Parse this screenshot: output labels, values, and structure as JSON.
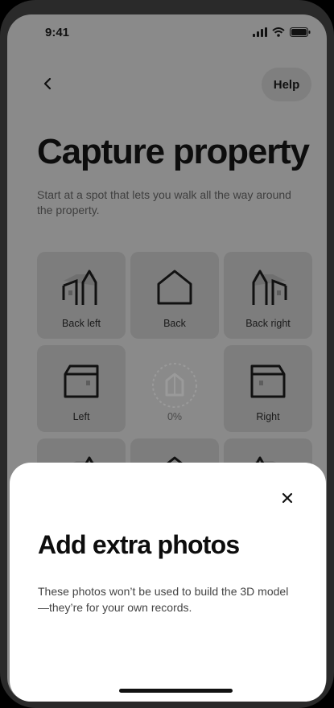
{
  "status_bar": {
    "time": "9:41"
  },
  "nav": {
    "help_label": "Help"
  },
  "header": {
    "title": "Capture property",
    "subtitle": "Start at a spot that lets you walk all the way around the property."
  },
  "tiles": [
    {
      "label": "Back left",
      "icon": "house-back-left-icon"
    },
    {
      "label": "Back",
      "icon": "house-back-icon"
    },
    {
      "label": "Back right",
      "icon": "house-back-right-icon"
    },
    {
      "label": "Left",
      "icon": "house-left-icon"
    },
    {
      "label": "0%",
      "icon": "progress-house-icon",
      "progress": 0
    },
    {
      "label": "Right",
      "icon": "house-right-icon"
    }
  ],
  "sheet": {
    "title": "Add extra photos",
    "body": "These photos won’t be used to build the 3D model—they’re for your own records."
  },
  "colors": {
    "overlay": "#8a8a8a",
    "tile_bg": "#7d7d7d",
    "sheet_bg": "#ffffff",
    "text_primary": "#0d0d0d"
  }
}
